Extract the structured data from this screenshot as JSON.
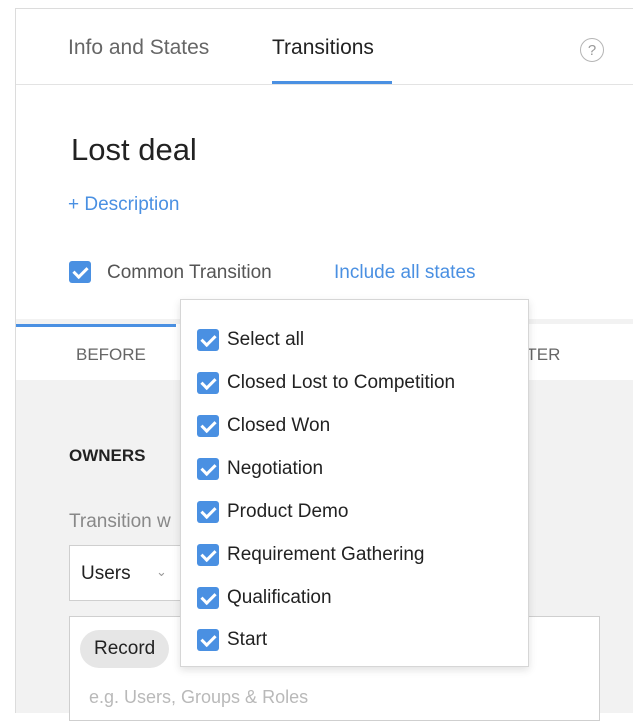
{
  "tabs": {
    "info": "Info and States",
    "transitions": "Transitions",
    "help": "?"
  },
  "transition": {
    "name": "Lost deal",
    "description_link": "+ Description",
    "common_transition_label": "Common Transition",
    "common_transition_checked": true,
    "include_all_link": "Include all states"
  },
  "stages": {
    "before": "BEFORE",
    "after_partial": "FTER"
  },
  "owners": {
    "heading": "OWNERS",
    "transition_label_partial": "Transition w",
    "select_value": "Users",
    "chevron": "⌄",
    "token": "Record",
    "placeholder": "e.g. Users, Groups & Roles"
  },
  "dropdown": {
    "items": [
      {
        "label": "Select all",
        "checked": true
      },
      {
        "label": "Closed Lost to Competition",
        "checked": true
      },
      {
        "label": "Closed Won",
        "checked": true
      },
      {
        "label": "Negotiation",
        "checked": true
      },
      {
        "label": "Product Demo",
        "checked": true
      },
      {
        "label": "Requirement Gathering",
        "checked": true
      },
      {
        "label": "Qualification",
        "checked": true
      },
      {
        "label": "Start",
        "checked": true
      }
    ]
  },
  "colors": {
    "accent": "#4a90e2",
    "background": "#f2f2f2"
  }
}
